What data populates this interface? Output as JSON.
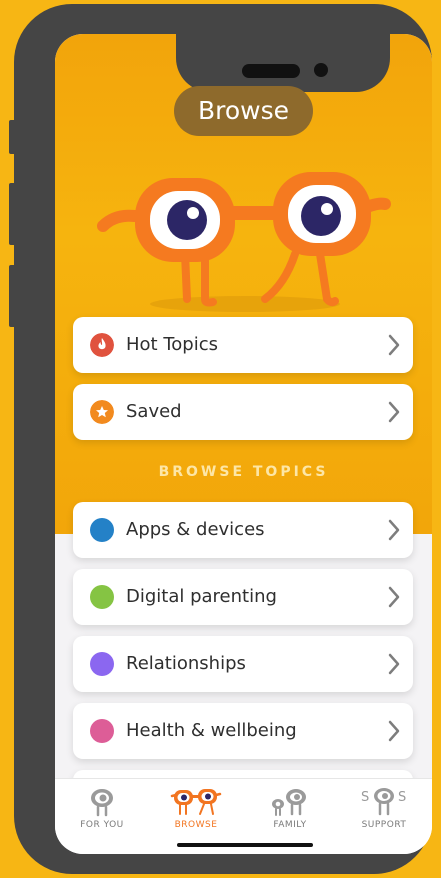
{
  "header": {
    "title": "Browse"
  },
  "quick_links": [
    {
      "label": "Hot Topics",
      "icon": "flame-icon",
      "color": "#e0523e"
    },
    {
      "label": "Saved",
      "icon": "star-icon",
      "color": "#f28a1e"
    }
  ],
  "section_label": "BROWSE TOPICS",
  "topics": [
    {
      "label": "Apps & devices",
      "color": "#2481c7"
    },
    {
      "label": "Digital parenting",
      "color": "#85c443"
    },
    {
      "label": "Relationships",
      "color": "#8b67f0"
    },
    {
      "label": "Health & wellbeing",
      "color": "#dd5d97"
    }
  ],
  "tabs": [
    {
      "label": "FOR YOU",
      "icon": "eye-mascot-icon",
      "active": false
    },
    {
      "label": "BROWSE",
      "icon": "glasses-mascot-icon",
      "active": true
    },
    {
      "label": "FAMILY",
      "icon": "family-mascot-icon",
      "active": false
    },
    {
      "label": "SUPPORT",
      "icon": "sos-mascot-icon",
      "active": false
    }
  ],
  "colors": {
    "background": "#f7b614",
    "accent": "#f27521",
    "hero": "#f4ae0c"
  }
}
